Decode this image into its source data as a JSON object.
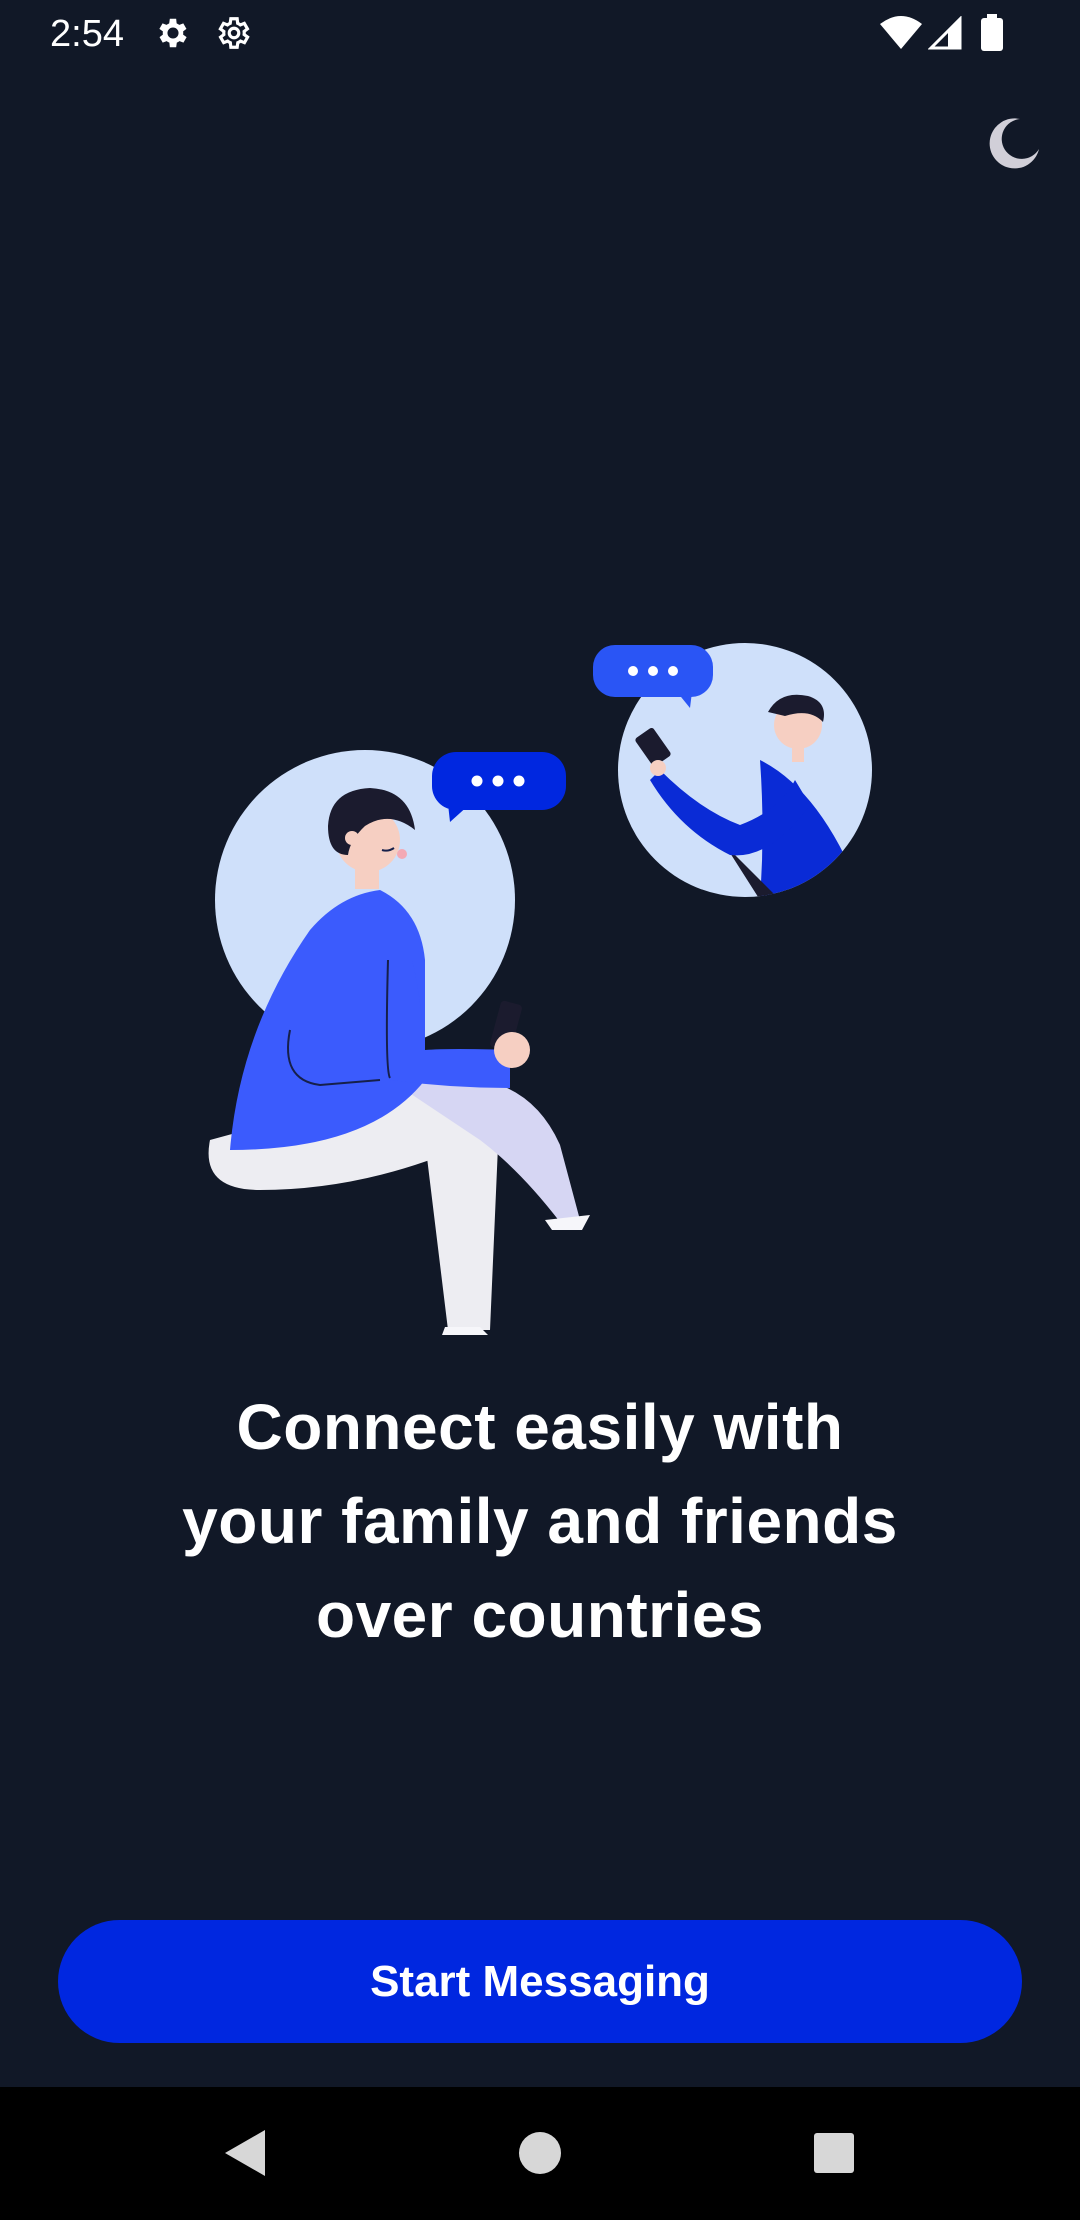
{
  "status_bar": {
    "time": "2:54",
    "icons": [
      "settings-gear-filled-icon",
      "settings-gear-outline-icon",
      "wifi-icon",
      "cellular-signal-icon",
      "battery-icon"
    ]
  },
  "header": {
    "theme_toggle_icon": "moon-icon"
  },
  "hero": {
    "illustration_icon": "people-chatting-illustration",
    "headline_lines": [
      "Connect easily with",
      "your family and friends",
      "over countries"
    ]
  },
  "cta": {
    "label": "Start Messaging"
  },
  "nav": {
    "icons": [
      "back-icon",
      "home-icon",
      "recents-icon"
    ]
  },
  "colors": {
    "background": "#111827",
    "primary": "#0027E0",
    "accent_blue": "#3B5BFD",
    "bubble_light": "#CFE0FA"
  }
}
